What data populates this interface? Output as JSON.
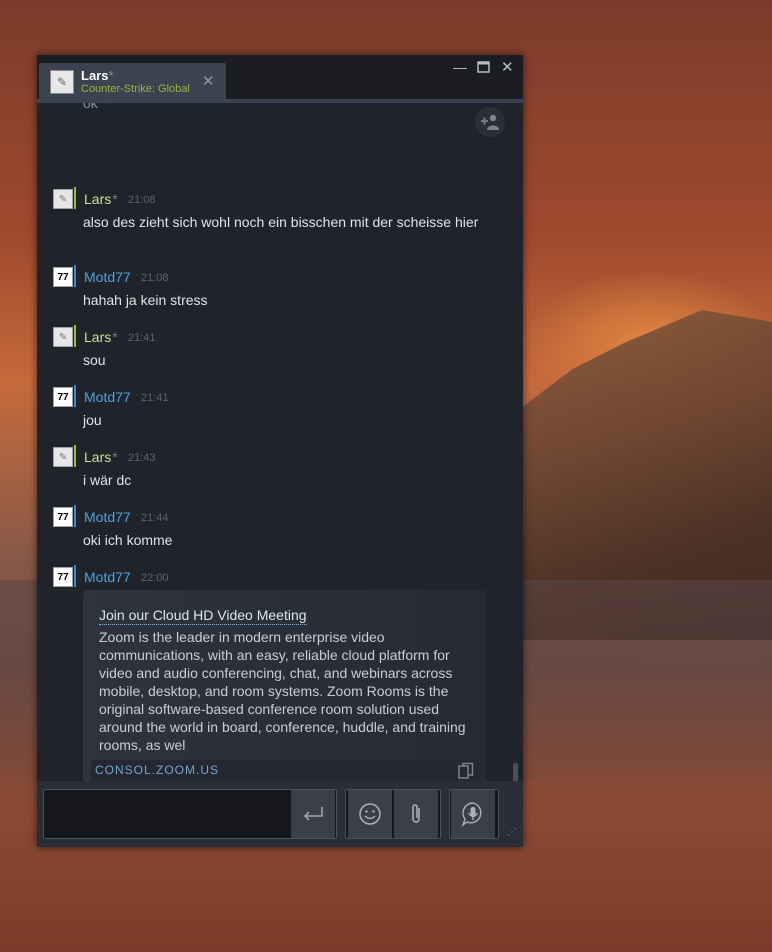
{
  "window": {
    "tab": {
      "name": "Lars",
      "status_mark": "*",
      "game": "Counter-Strike: Global Offensive"
    },
    "controls": [
      "minimize",
      "maximize",
      "close"
    ]
  },
  "icons": {
    "add_friend": "add-friend-icon",
    "copy": "copy-icon",
    "send": "send-icon",
    "emoji": "smiley-icon",
    "attach": "paperclip-icon",
    "voice": "microphone-icon"
  },
  "chat": {
    "cutoff_text": "ok***",
    "messages": [
      {
        "author": "Lars",
        "star": "*",
        "time": "21:08",
        "text": "also des zieht sich wohl noch ein bisschen mit der scheisse hier"
      },
      {
        "author": "Motd77",
        "time": "21:08",
        "text": "hahah ja kein stress"
      },
      {
        "author": "Lars",
        "star": "*",
        "time": "21:41",
        "text": "sou"
      },
      {
        "author": "Motd77",
        "time": "21:41",
        "text": "jou"
      },
      {
        "author": "Lars",
        "star": "*",
        "time": "21:43",
        "text": "i wär dc"
      },
      {
        "author": "Motd77",
        "time": "21:44",
        "text": "oki ich komme"
      },
      {
        "author": "Motd77",
        "time": "22:00",
        "text": ""
      }
    ],
    "avatar_motd": "77",
    "embed": {
      "title": "Join our Cloud HD Video Meeting",
      "description": "Zoom is the leader in modern enterprise video communications, with an easy, reliable cloud platform for video and audio conferencing, chat, and webinars across mobile, desktop, and room systems. Zoom Rooms is the original software-based conference room solution used around the world in board, conference, huddle, and training rooms, as wel",
      "url": "CONSOL.ZOOM.US"
    }
  },
  "input": {
    "value": "",
    "placeholder": ""
  },
  "colors": {
    "friend_name": "#c6e28a",
    "self_name": "#4aa3df",
    "game_status": "#90ba3c",
    "window_bg": "#202329"
  }
}
